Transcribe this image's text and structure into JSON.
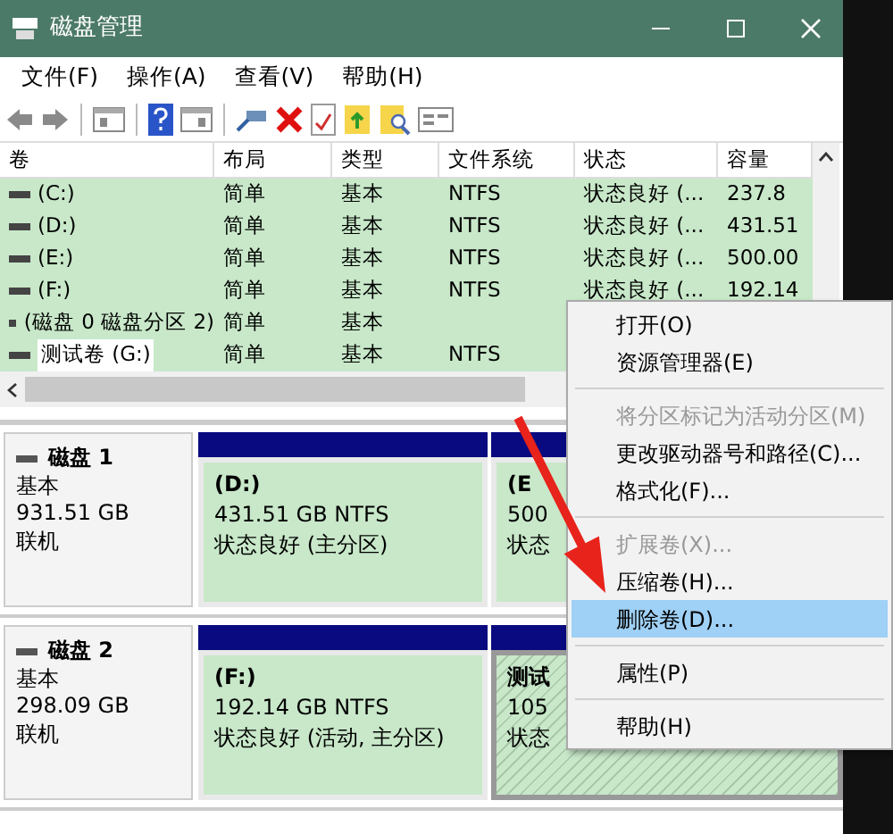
{
  "window": {
    "title": "磁盘管理"
  },
  "menu_bar": [
    "文件(F)",
    "操作(A)",
    "查看(V)",
    "帮助(H)"
  ],
  "volume_table": {
    "columns": [
      "卷",
      "布局",
      "类型",
      "文件系统",
      "状态",
      "容量"
    ],
    "rows": [
      {
        "cells": [
          "(C:)",
          "简单",
          "基本",
          "NTFS",
          "状态良好 (...",
          "237.8"
        ],
        "selected": false
      },
      {
        "cells": [
          "(D:)",
          "简单",
          "基本",
          "NTFS",
          "状态良好 (...",
          "431.51"
        ],
        "selected": false
      },
      {
        "cells": [
          "(E:)",
          "简单",
          "基本",
          "NTFS",
          "状态良好 (...",
          "500.00"
        ],
        "selected": false
      },
      {
        "cells": [
          "(F:)",
          "简单",
          "基本",
          "NTFS",
          "状态良好 (...",
          "192.14"
        ],
        "selected": false
      },
      {
        "cells": [
          "(磁盘 0 磁盘分区 2)",
          "简单",
          "基本",
          "",
          "",
          ""
        ],
        "selected": false
      },
      {
        "cells": [
          "测试卷 (G:)",
          "简单",
          "基本",
          "NTFS",
          "",
          ""
        ],
        "selected": true
      }
    ]
  },
  "disks": [
    {
      "name": "磁盘 1",
      "type": "基本",
      "size": "931.51 GB",
      "status": "联机",
      "partitions": [
        {
          "label": "(D:)",
          "size": "431.51 GB NTFS",
          "status": "状态良好 (主分区)",
          "selected": false
        },
        {
          "label": "(E",
          "size": "500",
          "status": "状态",
          "selected": false
        }
      ]
    },
    {
      "name": "磁盘 2",
      "type": "基本",
      "size": "298.09 GB",
      "status": "联机",
      "partitions": [
        {
          "label": "(F:)",
          "size": "192.14 GB NTFS",
          "status": "状态良好 (活动, 主分区)",
          "selected": false
        },
        {
          "label": "测试",
          "size": "105",
          "status": "状态",
          "selected": true
        }
      ]
    }
  ],
  "context_menu": {
    "items": [
      {
        "kind": "item",
        "label": "打开(O)",
        "disabled": false,
        "selected": false
      },
      {
        "kind": "item",
        "label": "资源管理器(E)",
        "disabled": false,
        "selected": false
      },
      {
        "kind": "separator"
      },
      {
        "kind": "item",
        "label": "将分区标记为活动分区(M)",
        "disabled": true,
        "selected": false
      },
      {
        "kind": "item",
        "label": "更改驱动器号和路径(C)...",
        "disabled": false,
        "selected": false
      },
      {
        "kind": "item",
        "label": "格式化(F)...",
        "disabled": false,
        "selected": false
      },
      {
        "kind": "separator"
      },
      {
        "kind": "item",
        "label": "扩展卷(X)...",
        "disabled": true,
        "selected": false
      },
      {
        "kind": "item",
        "label": "压缩卷(H)...",
        "disabled": false,
        "selected": false
      },
      {
        "kind": "item",
        "label": "删除卷(D)...",
        "disabled": false,
        "selected": true
      },
      {
        "kind": "separator"
      },
      {
        "kind": "item",
        "label": "属性(P)",
        "disabled": false,
        "selected": false
      },
      {
        "kind": "separator"
      },
      {
        "kind": "item",
        "label": "帮助(H)",
        "disabled": false,
        "selected": false
      }
    ]
  }
}
